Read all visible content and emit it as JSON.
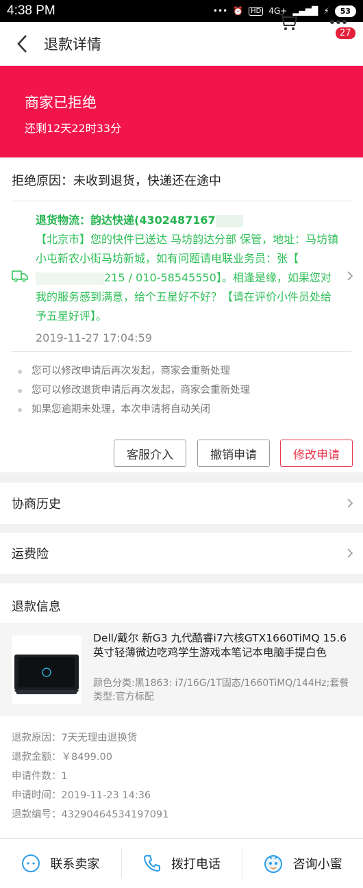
{
  "status_bar": {
    "time": "4:38 PM",
    "signal": "4G+",
    "battery": "53"
  },
  "nav": {
    "title": "退款详情",
    "badge_count": "27"
  },
  "hero": {
    "status": "商家已拒绝",
    "countdown": "还剩12天22时33分"
  },
  "reject_reason": "拒绝原因：未收到退货，快递还在途中",
  "logistics": {
    "title": "退货物流：韵达快递(4302487167",
    "detail": "【北京市】您的快件已送达 马坊韵达分部 保管，地址：马坊镇小屯新农小街马坊新城，如有问题请电联业务员：张【",
    "detail_phone": "215 / 010-58545550",
    "detail_end": "】。相逢是缘，如果您对我的服务感到满意，给个五星好不好？【请在评价小件员处给予五星好评】。",
    "time": "2019-11-27 17:04:59"
  },
  "tips": [
    "您可以修改申请后再次发起，商家会重新处理",
    "您可以修改退货申请后再次发起，商家会重新处理",
    "如果您逾期未处理，本次申请将自动关闭"
  ],
  "actions": {
    "service": "客服介入",
    "cancel": "撤销申请",
    "modify": "修改申请"
  },
  "rows": {
    "history": "协商历史",
    "insurance": "运费险"
  },
  "refund": {
    "title": "退款信息",
    "product_name": "Dell/戴尔 新G3 九代酷睿i7六核GTX1660TiMQ 15.6英寸轻薄微边吃鸡学生游戏本笔记本电脑手提白色",
    "product_spec": "颜色分类:黑1863: i7/16G/1T固态/1660TiMQ/144Hz;套餐类型:官方标配",
    "info": [
      "退款原因：7天无理由退换货",
      "退款金额：￥8499.00",
      "申请件数：1",
      "申请时间：2019-11-23 14:36",
      "退款编号：43290464534197091"
    ]
  },
  "bottom": {
    "contact": "联系卖家",
    "call": "拨打电话",
    "ask": "咨询小蜜"
  },
  "colors": {
    "accent": "#f2154c",
    "logistics": "#2fbf58"
  }
}
